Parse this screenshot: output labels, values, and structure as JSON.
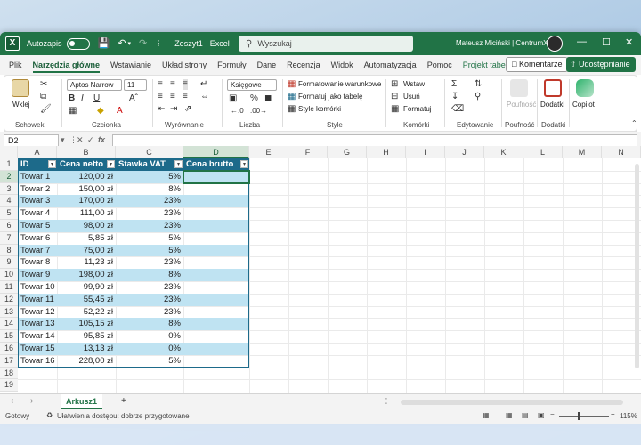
{
  "titlebar": {
    "autosave_label": "Autozapis",
    "doc_title": "Zeszyt1 · Excel",
    "search_placeholder": "Wyszukaj",
    "user_name": "Mateusz Miciński | CentrumXP"
  },
  "menu": {
    "tabs": [
      "Plik",
      "Narzędzia główne",
      "Wstawianie",
      "Układ strony",
      "Formuły",
      "Dane",
      "Recenzja",
      "Widok",
      "Automatyzacja",
      "Pomoc",
      "Projekt tabeli"
    ],
    "comments": "Komentarze",
    "share": "Udostępnianie"
  },
  "ribbon": {
    "paste": "Wklej",
    "font_name": "Aptos Narrow",
    "font_size": "11",
    "number_format": "Księgowe",
    "cond_format": "Formatowanie warunkowe",
    "format_table": "Formatuj jako tabelę",
    "cell_styles": "Style komórki",
    "insert": "Wstaw",
    "delete": "Usuń",
    "format": "Formatuj",
    "sensitivity": "Poufność",
    "addins": "Dodatki",
    "copilot": "Copilot",
    "groups": [
      "Schowek",
      "Czcionka",
      "Wyrównanie",
      "Liczba",
      "Style",
      "Komórki",
      "Edytowanie",
      "Poufność",
      "Dodatki"
    ]
  },
  "formula_bar": {
    "name_box": "D2",
    "value": ""
  },
  "grid": {
    "columns": [
      "A",
      "B",
      "C",
      "D",
      "E",
      "F",
      "G",
      "H",
      "I",
      "J",
      "K",
      "L",
      "M",
      "N"
    ],
    "rows": [
      "1",
      "2",
      "3",
      "4",
      "5",
      "6",
      "7",
      "8",
      "9",
      "10",
      "11",
      "12",
      "13",
      "14",
      "15",
      "16",
      "17",
      "18",
      "19"
    ],
    "table_headers": [
      "ID",
      "Cena netto",
      "Stawka VAT",
      "Cena brutto"
    ],
    "table_rows": [
      [
        "Towar 1",
        "120,00 zł",
        "5%"
      ],
      [
        "Towar 2",
        "150,00 zł",
        "8%"
      ],
      [
        "Towar 3",
        "170,00 zł",
        "23%"
      ],
      [
        "Towar 4",
        "111,00 zł",
        "23%"
      ],
      [
        "Towar 5",
        "98,00 zł",
        "23%"
      ],
      [
        "Towar 6",
        "5,85 zł",
        "5%"
      ],
      [
        "Towar 7",
        "75,00 zł",
        "5%"
      ],
      [
        "Towar 8",
        "11,23 zł",
        "23%"
      ],
      [
        "Towar 9",
        "198,00 zł",
        "8%"
      ],
      [
        "Towar 10",
        "99,90 zł",
        "23%"
      ],
      [
        "Towar 11",
        "55,45 zł",
        "23%"
      ],
      [
        "Towar 12",
        "52,22 zł",
        "23%"
      ],
      [
        "Towar 13",
        "105,15 zł",
        "8%"
      ],
      [
        "Towar 14",
        "95,85 zł",
        "0%"
      ],
      [
        "Towar 15",
        "13,13 zł",
        "0%"
      ],
      [
        "Towar 16",
        "228,00 zł",
        "5%"
      ]
    ]
  },
  "sheets": {
    "active": "Arkusz1"
  },
  "status": {
    "ready": "Gotowy",
    "accessibility": "Ułatwienia dostępu: dobrze przygotowane",
    "zoom": "115%"
  },
  "colors": {
    "excel_green": "#217346",
    "table_header": "#1d6a8a",
    "table_band": "#bfe3f2"
  }
}
